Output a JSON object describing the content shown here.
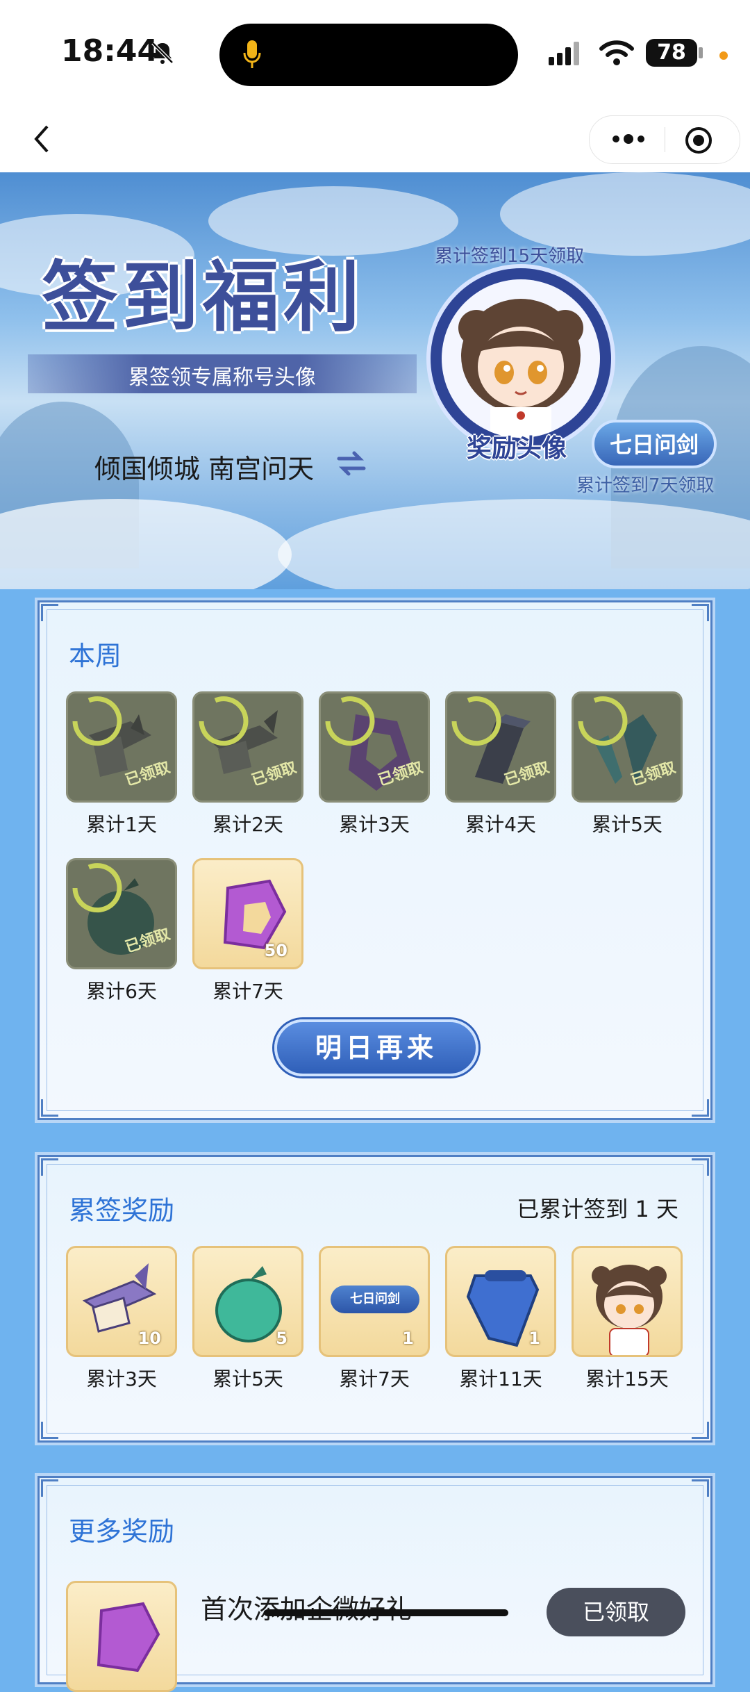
{
  "status_bar": {
    "time": "18:44",
    "battery": "78"
  },
  "hero": {
    "title": "签到福利",
    "subtitle": "累签领专属称号头像",
    "username": "倾国倾城 南宫问天",
    "cum15_label": "累计签到15天领取",
    "avatar_label": "奖励头像",
    "title_badge": "七日问剑",
    "cum7_label": "累计签到7天领取"
  },
  "weekly": {
    "title": "本周",
    "claimed_stamp": "已领取",
    "items": [
      {
        "label": "累计1天",
        "claimed": true
      },
      {
        "label": "累计2天",
        "claimed": true
      },
      {
        "label": "累计3天",
        "claimed": true
      },
      {
        "label": "累计4天",
        "claimed": true
      },
      {
        "label": "累计5天",
        "claimed": true
      },
      {
        "label": "累计6天",
        "claimed": true
      },
      {
        "label": "累计7天",
        "claimed": false,
        "qty": "50"
      }
    ],
    "button_label": "明日再来"
  },
  "cumulative": {
    "title": "累签奖励",
    "progress_text": "已累计签到 1 天",
    "items": [
      {
        "label": "累计3天",
        "qty": "10"
      },
      {
        "label": "累计5天",
        "qty": "5"
      },
      {
        "label": "累计7天",
        "qty": "1",
        "badge": "七日问剑"
      },
      {
        "label": "累计11天",
        "qty": "1"
      },
      {
        "label": "累计15天",
        "qty": ""
      }
    ]
  },
  "more": {
    "title": "更多奖励",
    "first_item_text": "首次添加企微好礼",
    "first_item_button": "已领取"
  },
  "colors": {
    "accent_blue": "#2e73d6",
    "panel_border": "#4f7fc4",
    "claimed_tile": "#6f7560",
    "gold_tile": "#f3d99c"
  }
}
